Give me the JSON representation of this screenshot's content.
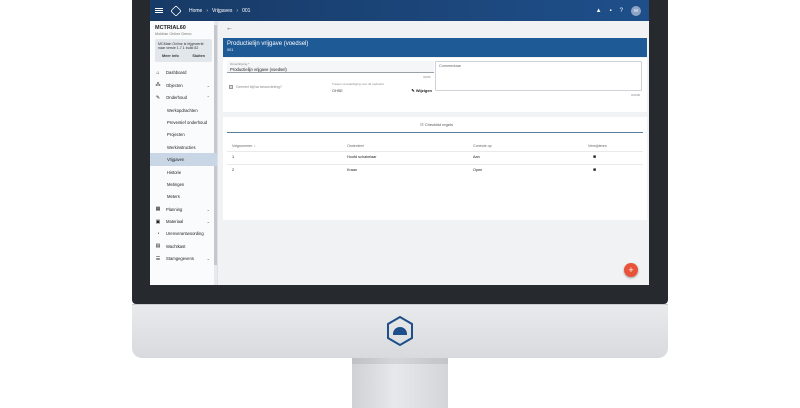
{
  "topbar": {
    "crumbs": [
      "Home",
      "Vrijgaves",
      "001"
    ]
  },
  "sidebar": {
    "title": "MCTRIAL60",
    "subtitle": "Mobilan Online Demo",
    "info_text": "MCMain Online is bijgewerkt naar versie 1.7.1 build 82",
    "info_more": "Meer info",
    "info_close": "Sluiten",
    "items": [
      {
        "label": "Dashboard",
        "icon": "home-icon"
      },
      {
        "label": "Objecten",
        "icon": "hierarchy-icon"
      },
      {
        "label": "Onderhoud",
        "icon": "wrench-icon"
      },
      {
        "label": "Werkopdrachten"
      },
      {
        "label": "Preventief onderhoud"
      },
      {
        "label": "Projecten"
      },
      {
        "label": "Werkinstructies"
      },
      {
        "label": "Vrijgaven"
      },
      {
        "label": "Historie"
      },
      {
        "label": "Metingen"
      },
      {
        "label": "Meters"
      },
      {
        "label": "Planning",
        "icon": "calendar-icon"
      },
      {
        "label": "Materiaal",
        "icon": "box-icon"
      },
      {
        "label": "Urenverantwoording",
        "icon": "clock-icon"
      },
      {
        "label": "Wachtkast",
        "icon": "inbox-icon"
      },
      {
        "label": "Stamgegevens",
        "icon": "list-icon"
      }
    ]
  },
  "main": {
    "title": "Productielijn vrijgave (voedsel)",
    "subtitle": "001",
    "omschrijving_label": "Omschrijving *",
    "omschrijving_value": "Productielijn vrijgave (voedsel)",
    "omschrijving_count": "32/80",
    "checkbox_label": "Gereed bij/na beoordeling?",
    "plan_label": "Tussen vervaardiging voor dit opdracht",
    "plan_value": "OHSE",
    "plan_button": "Wijzigen",
    "comment_label": "Commentaar",
    "comment_count": "0/4000",
    "table": {
      "title": "Checklist regels",
      "headers": [
        "Volgnummer",
        "Onderdeel",
        "Controle op",
        "Verwijderen"
      ],
      "rows": [
        {
          "nr": "1",
          "part": "Hoofd schakelaar",
          "check": "Aan"
        },
        {
          "nr": "2",
          "part": "Kraan",
          "check": "Open"
        }
      ]
    }
  },
  "colors": {
    "topbar": "#1e4f8a",
    "headbar": "#1e5a96",
    "fab": "#e8533a",
    "active_nav": "#c9d6e5"
  }
}
